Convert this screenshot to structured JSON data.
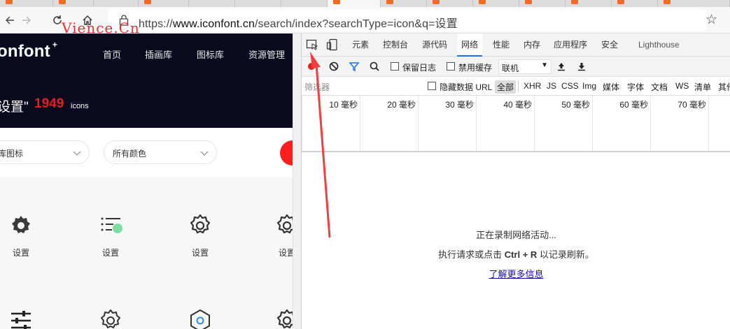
{
  "browser": {
    "address_bar": {
      "url_prefix": "https://",
      "url_host": "www.iconfont.cn",
      "url_path": "/search/index?searchType=icon&q=设置",
      "back_icon": "back-arrow-icon",
      "forward_icon": "forward-arrow-icon",
      "reload_icon": "reload-icon",
      "home_icon": "home-icon",
      "lock_icon": "lock-icon",
      "favorite_icon": "star-icon"
    },
    "watermark": "Vience.Cn",
    "tab_accent": "#f06a2a"
  },
  "page": {
    "logo": "onfont",
    "logo_mark": "+",
    "nav": [
      "首页",
      "插画库",
      "图标库",
      "资源管理"
    ],
    "result_title": "设置\"",
    "result_count": "1949",
    "result_unit": "icons",
    "filters": [
      "库图标",
      "所有颜色"
    ],
    "brand_color": "#ff1e1e",
    "icons": [
      {
        "name": "设置",
        "icon": "gear-filled-icon"
      },
      {
        "name": "设置",
        "icon": "list-settings-icon"
      },
      {
        "name": "设置",
        "icon": "gear-outline-icon"
      },
      {
        "name": "设置",
        "icon": "gear-outline-icon"
      },
      {
        "name": "",
        "icon": "sliders-icon"
      },
      {
        "name": "",
        "icon": "gear-outline-icon"
      },
      {
        "name": "",
        "icon": "hexagon-icon"
      },
      {
        "name": "",
        "icon": "gear-outline-icon"
      }
    ]
  },
  "devtools": {
    "tabs": [
      "元素",
      "控制台",
      "源代码",
      "网络",
      "性能",
      "内存",
      "应用程序",
      "安全",
      "Lighthouse"
    ],
    "active_tab": "网络",
    "toolbar": {
      "preserve_log": "保留日志",
      "disable_cache": "禁用缓存",
      "throttling": "联机"
    },
    "filter": {
      "placeholder": "筛选器",
      "hide_data_urls": "隐藏数据 URL",
      "types": [
        "全部",
        "XHR",
        "JS",
        "CSS",
        "Img",
        "媒体",
        "字体",
        "文档",
        "WS",
        "清单",
        "其他"
      ],
      "active_type": "全部"
    },
    "timeline_ticks": [
      "10 毫秒",
      "20 毫秒",
      "30 毫秒",
      "40 毫秒",
      "50 毫秒",
      "60 毫秒",
      "70 毫秒"
    ],
    "empty_state": {
      "line1": "正在录制网络活动...",
      "line2_prefix": "执行请求或点击 ",
      "line2_keys": "Ctrl + R",
      "line2_suffix": " 以记录刷新。",
      "link": "了解更多信息"
    },
    "accent": "#1a73e8",
    "record_color": "#e52020"
  },
  "annotation": {
    "color": "#ef4040",
    "shape": "arrow"
  }
}
